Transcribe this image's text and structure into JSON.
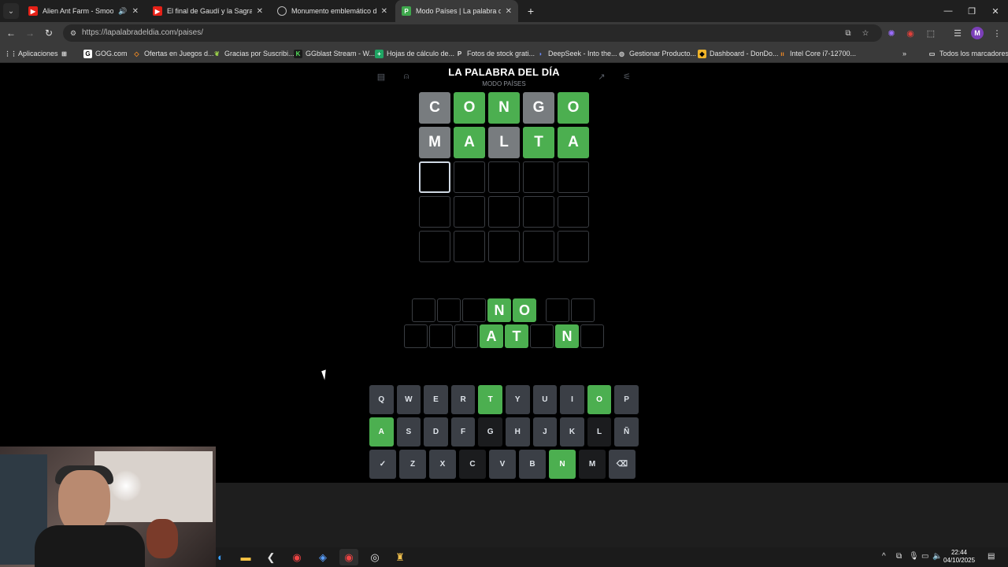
{
  "browser": {
    "tabs": [
      {
        "label": "Alien Ant Farm - Smooth C",
        "favicon": "youtube-icon",
        "audio": true
      },
      {
        "label": "El final de Gaudí y la Sagrada F",
        "favicon": "youtube-icon"
      },
      {
        "label": "Monumento emblemático de E",
        "favicon": "globe-icon"
      },
      {
        "label": "Modo Países | La palabra del dí",
        "favicon": "P",
        "active": true
      }
    ],
    "url": "https://lapalabradeldia.com/paises/",
    "bookmarks": [
      "Aplicaciones",
      "GOG.com",
      "Ofertas en Juegos d...",
      "Gracias por Suscribi...",
      "GGblast Stream - W...",
      "Hojas de cálculo de...",
      "Fotos de stock grati...",
      "DeepSeek - Into the...",
      "Gestionar Producto...",
      "Dashboard - DonDo...",
      "Intel Core i7-12700...",
      "Todos los marcadores"
    ],
    "profile_initial": "M"
  },
  "game": {
    "title": "LA PALABRA DEL DÍA",
    "subtitle": "MODO PAÍSES",
    "board": [
      [
        {
          "l": "C",
          "s": "absent"
        },
        {
          "l": "O",
          "s": "correct"
        },
        {
          "l": "N",
          "s": "correct"
        },
        {
          "l": "G",
          "s": "absent"
        },
        {
          "l": "O",
          "s": "correct"
        }
      ],
      [
        {
          "l": "M",
          "s": "absent"
        },
        {
          "l": "A",
          "s": "correct"
        },
        {
          "l": "L",
          "s": "absent"
        },
        {
          "l": "T",
          "s": "correct"
        },
        {
          "l": "A",
          "s": "correct"
        }
      ],
      [
        {
          "l": "",
          "s": "focus"
        },
        {
          "l": "",
          "s": "empty"
        },
        {
          "l": "",
          "s": "empty"
        },
        {
          "l": "",
          "s": "empty"
        },
        {
          "l": "",
          "s": "empty"
        }
      ],
      [
        {
          "l": "",
          "s": "empty"
        },
        {
          "l": "",
          "s": "empty"
        },
        {
          "l": "",
          "s": "empty"
        },
        {
          "l": "",
          "s": "empty"
        },
        {
          "l": "",
          "s": "empty"
        }
      ],
      [
        {
          "l": "",
          "s": "empty"
        },
        {
          "l": "",
          "s": "empty"
        },
        {
          "l": "",
          "s": "empty"
        },
        {
          "l": "",
          "s": "empty"
        },
        {
          "l": "",
          "s": "empty"
        }
      ]
    ],
    "answer_row_1": [
      "",
      "",
      "",
      "N",
      "O",
      "|",
      "",
      ""
    ],
    "answer_row_2": [
      "",
      "",
      "",
      "A",
      "T",
      "",
      "N",
      ""
    ],
    "keyboard": [
      [
        {
          "k": "Q"
        },
        {
          "k": "W"
        },
        {
          "k": "E"
        },
        {
          "k": "R"
        },
        {
          "k": "T",
          "s": "correct"
        },
        {
          "k": "Y"
        },
        {
          "k": "U"
        },
        {
          "k": "I"
        },
        {
          "k": "O",
          "s": "correct"
        },
        {
          "k": "P"
        }
      ],
      [
        {
          "k": "A",
          "s": "correct"
        },
        {
          "k": "S"
        },
        {
          "k": "D"
        },
        {
          "k": "F"
        },
        {
          "k": "G",
          "s": "absent"
        },
        {
          "k": "H"
        },
        {
          "k": "J"
        },
        {
          "k": "K"
        },
        {
          "k": "L",
          "s": "absent"
        },
        {
          "k": "Ñ"
        }
      ],
      [
        {
          "k": "✓"
        },
        {
          "k": "Z"
        },
        {
          "k": "X"
        },
        {
          "k": "C",
          "s": "absent"
        },
        {
          "k": "V"
        },
        {
          "k": "B"
        },
        {
          "k": "N",
          "s": "correct"
        },
        {
          "k": "M",
          "s": "absent"
        },
        {
          "k": "⌫"
        }
      ]
    ]
  },
  "taskbar": {
    "time": "22:44",
    "date": "04/10/2025"
  },
  "colors": {
    "correct": "#4caf50",
    "absent": "#787c7f",
    "key_default": "#3b3f46"
  }
}
